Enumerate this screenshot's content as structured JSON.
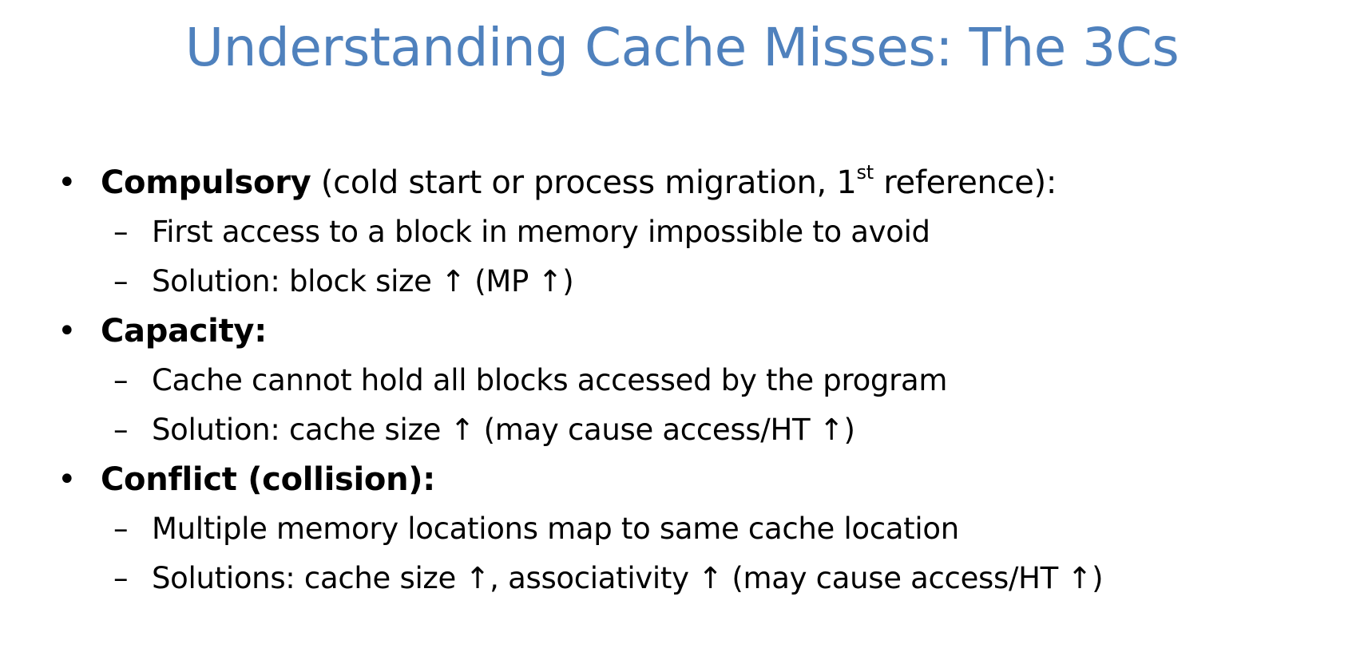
{
  "slide": {
    "title": "Understanding Cache Misses: The 3Cs",
    "bullet_marker": "•",
    "sub_marker": "–",
    "items": [
      {
        "label": "Compulsory",
        "detail_before": " (cold start or process migration, 1",
        "detail_sup": "st",
        "detail_after": " reference):",
        "subitems": [
          "First access to a block in memory impossible to avoid",
          "Solution:  block size ↑ (MP ↑)"
        ]
      },
      {
        "label": "Capacity:",
        "subitems": [
          "Cache cannot hold all blocks accessed by the program",
          "Solution:  cache size ↑ (may cause access/HT ↑)"
        ]
      },
      {
        "label": "Conflict (collision):",
        "subitems": [
          "Multiple memory locations map to same cache location",
          "Solutions:  cache size ↑, associativity ↑ (may cause access/HT ↑)"
        ]
      }
    ]
  }
}
